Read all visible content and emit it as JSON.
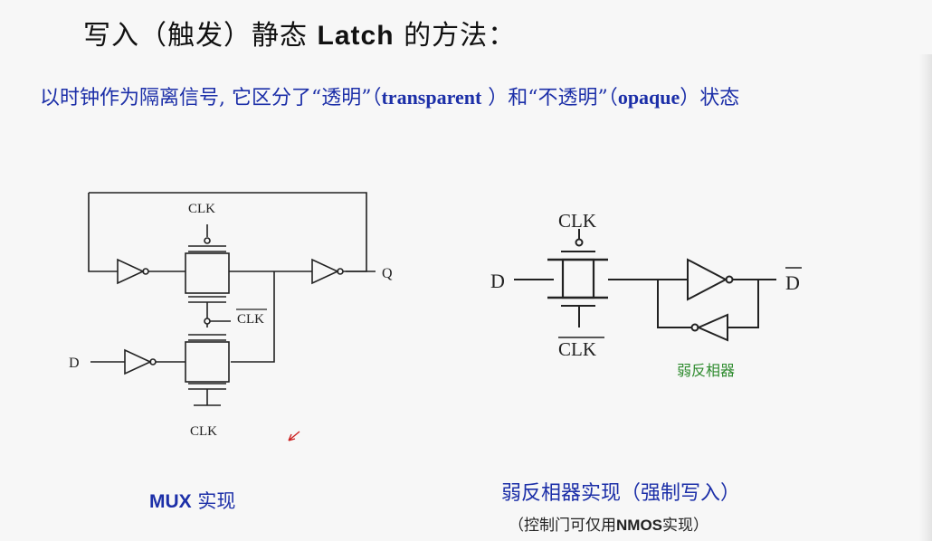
{
  "title": {
    "prefix": "写入（触发）静态 ",
    "bold": "Latch",
    "suffix": " 的方法："
  },
  "subtitle": {
    "part1": "以时钟作为隔离信号, 它区分了“透明”（",
    "en1": "transparent",
    "part2": " ）和“不透明”（",
    "en2": "opaque",
    "part3": "）状态"
  },
  "mux_circuit": {
    "clk_top": "CLK",
    "clk_bar_mid": "CLK",
    "clk_bottom": "CLK",
    "input_d": "D",
    "output_q": "Q"
  },
  "weak_circuit": {
    "clk_top": "CLK",
    "clk_bar_bottom": "CLK",
    "input_d": "D",
    "output_dbar": "D",
    "weak_inverter_label": "弱反相器"
  },
  "captions": {
    "mux_en": "MUX",
    "mux_cn": " 实现",
    "weak": "弱反相器实现（强制写入）",
    "note_prefix": "（控制门可仅用",
    "note_en": "NMOS",
    "note_suffix": "实现）"
  },
  "colors": {
    "accent_blue": "#1c2fa8",
    "label_green": "#2e8b2e",
    "wire": "#222222",
    "cursor_red": "#cc2222"
  }
}
